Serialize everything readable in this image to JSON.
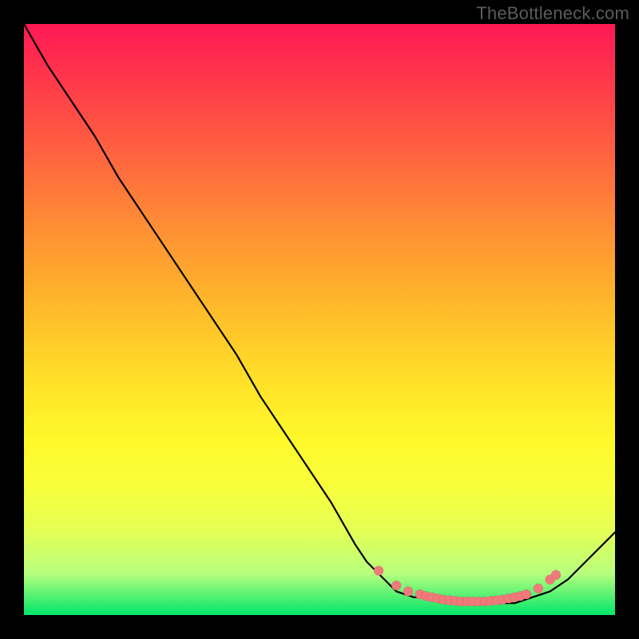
{
  "watermark": "TheBottleneck.com",
  "chart_data": {
    "type": "line",
    "title": "",
    "xlabel": "",
    "ylabel": "",
    "xlim": [
      0,
      100
    ],
    "ylim": [
      0,
      100
    ],
    "grid": false,
    "legend": false,
    "series": [
      {
        "name": "curve",
        "x": [
          0,
          4,
          8,
          12,
          16,
          20,
          24,
          28,
          32,
          36,
          40,
          44,
          48,
          52,
          56,
          58,
          61,
          63,
          66,
          68,
          71,
          73,
          76,
          78,
          81,
          83,
          86,
          89,
          92,
          95,
          98,
          100
        ],
        "y": [
          100,
          93,
          87,
          81,
          74,
          68,
          62,
          56,
          50,
          44,
          37,
          31,
          25,
          19,
          12,
          9,
          6,
          4,
          3,
          3,
          2,
          2,
          2,
          2,
          2,
          2,
          3,
          4,
          6,
          9,
          12,
          14
        ]
      }
    ],
    "markers": {
      "name": "dots",
      "x": [
        60,
        63,
        65,
        67,
        68,
        69,
        70,
        71,
        72,
        73,
        74,
        75,
        76,
        77,
        78,
        79,
        80,
        81,
        82,
        83,
        84,
        85,
        87,
        89,
        90
      ],
      "y": [
        7.5,
        5.0,
        4.0,
        3.5,
        3.2,
        3.0,
        2.8,
        2.6,
        2.5,
        2.4,
        2.3,
        2.3,
        2.3,
        2.3,
        2.3,
        2.4,
        2.5,
        2.6,
        2.8,
        3.0,
        3.2,
        3.5,
        4.5,
        6.0,
        6.8
      ]
    }
  }
}
